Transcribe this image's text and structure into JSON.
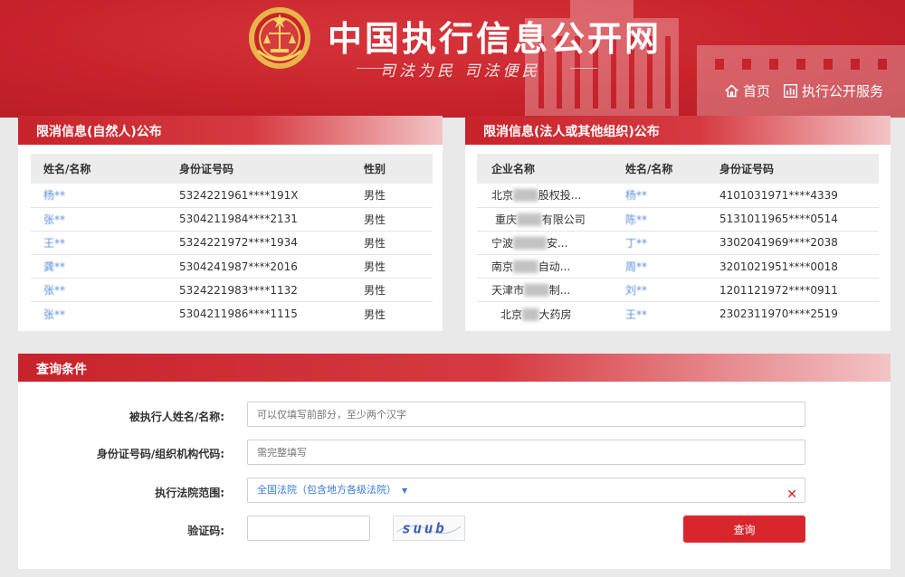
{
  "header": {
    "site_title": "中国执行信息公开网",
    "slogan": "司法为民  司法便民",
    "nav": [
      {
        "label": "首页",
        "icon": "home-icon"
      },
      {
        "label": "执行公开服务",
        "icon": "chart-icon"
      }
    ]
  },
  "natural_panel": {
    "title": "限消信息(自然人)公布",
    "columns": [
      "姓名/名称",
      "身份证号码",
      "性别"
    ],
    "rows": [
      {
        "name": "杨**",
        "id": "5324221961****191X",
        "gender": "男性"
      },
      {
        "name": "张**",
        "id": "5304211984****2131",
        "gender": "男性"
      },
      {
        "name": "王**",
        "id": "5324221972****1934",
        "gender": "男性"
      },
      {
        "name": "龚**",
        "id": "5304241987****2016",
        "gender": "男性"
      },
      {
        "name": "张**",
        "id": "5324221983****1132",
        "gender": "男性"
      },
      {
        "name": "张**",
        "id": "5304211986****1115",
        "gender": "男性"
      }
    ]
  },
  "org_panel": {
    "title": "限消信息(法人或其他组织)公布",
    "columns": [
      "企业名称",
      "姓名/名称",
      "身份证号码"
    ],
    "rows": [
      {
        "company_prefix": "北京",
        "company_suffix": "股权投...",
        "name": "杨**",
        "id": "4101031971****4339"
      },
      {
        "company_prefix": "重庆",
        "company_suffix": "有限公司",
        "name": "陈**",
        "id": "5131011965****0514"
      },
      {
        "company_prefix": "宁波",
        "company_suffix": "安...",
        "name": "丁**",
        "id": "3302041969****2038"
      },
      {
        "company_prefix": "南京",
        "company_suffix": "自动...",
        "name": "周**",
        "id": "3201021951****0018"
      },
      {
        "company_prefix": "天津市",
        "company_suffix": "制...",
        "name": "刘**",
        "id": "1201121972****0911"
      },
      {
        "company_prefix": "北京",
        "company_suffix": "大药房",
        "name": "王**",
        "id": "2302311970****2519"
      }
    ]
  },
  "query": {
    "title": "查询条件",
    "name_label": "被执行人姓名/名称:",
    "name_placeholder": "可以仅填写前部分，至少两个汉字",
    "id_label": "身份证号码/组织机构代码:",
    "id_placeholder": "需完整填写",
    "court_label": "执行法院范围:",
    "court_value": "全国法院（包含地方各级法院）",
    "captcha_label": "验证码:",
    "captcha_text": "suub",
    "submit_label": "查询"
  }
}
